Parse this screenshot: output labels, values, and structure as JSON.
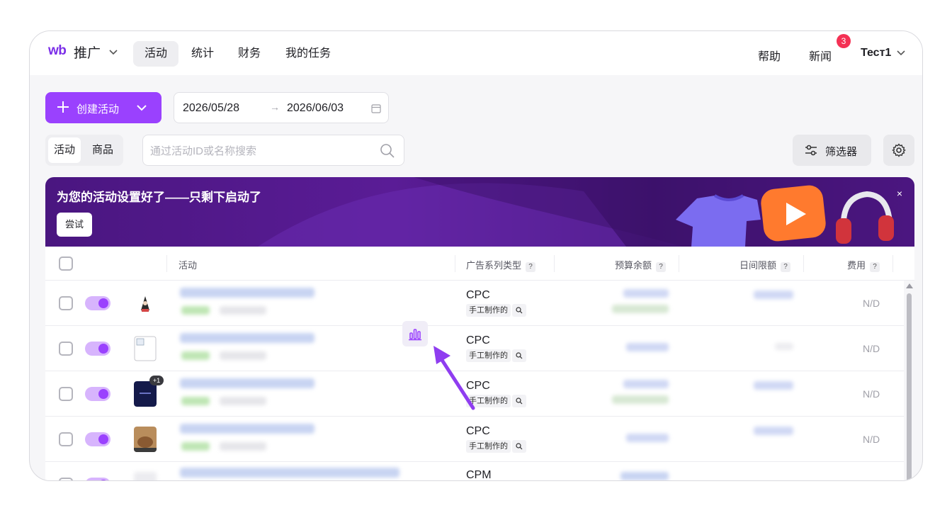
{
  "nav": {
    "logo": "wb",
    "brand": "推广",
    "tabs": [
      "活动",
      "统计",
      "财务",
      "我的任务"
    ],
    "help": "帮助",
    "news": "新闻",
    "news_badge": "3",
    "user": "Тест1"
  },
  "toolbar": {
    "create_label": "创建活动",
    "date_from": "2026/05/28",
    "date_arrow": "→",
    "date_to": "2026/06/03",
    "segments": [
      "活动",
      "商品"
    ],
    "search_placeholder": "通过活动ID或名称搜索",
    "filter_label": "筛选器"
  },
  "banner": {
    "title": "为您的活动设置好了——只剩下启动了",
    "try_label": "尝试",
    "close": "×"
  },
  "table": {
    "headers": {
      "campaign": "活动",
      "ad_type": "广告系列类型",
      "budget": "预算余额",
      "daily_limit": "日间限额",
      "cost": "费用"
    },
    "help_mark": "?",
    "rows": [
      {
        "type": "CPC",
        "tag": "手工制作的",
        "cost": "N/D"
      },
      {
        "type": "CPC",
        "tag": "手工制作的",
        "cost": "N/D"
      },
      {
        "type": "CPC",
        "tag": "手工制作的",
        "cost": "N/D",
        "thumb_badge": "+1"
      },
      {
        "type": "CPC",
        "tag": "手工制作的",
        "cost": "N/D"
      },
      {
        "type": "CPM"
      }
    ]
  },
  "colors": {
    "accent": "#9a41fe",
    "toggle_track": "#d7b4fd",
    "badge": "#f43154",
    "banner": "#4a1680"
  }
}
